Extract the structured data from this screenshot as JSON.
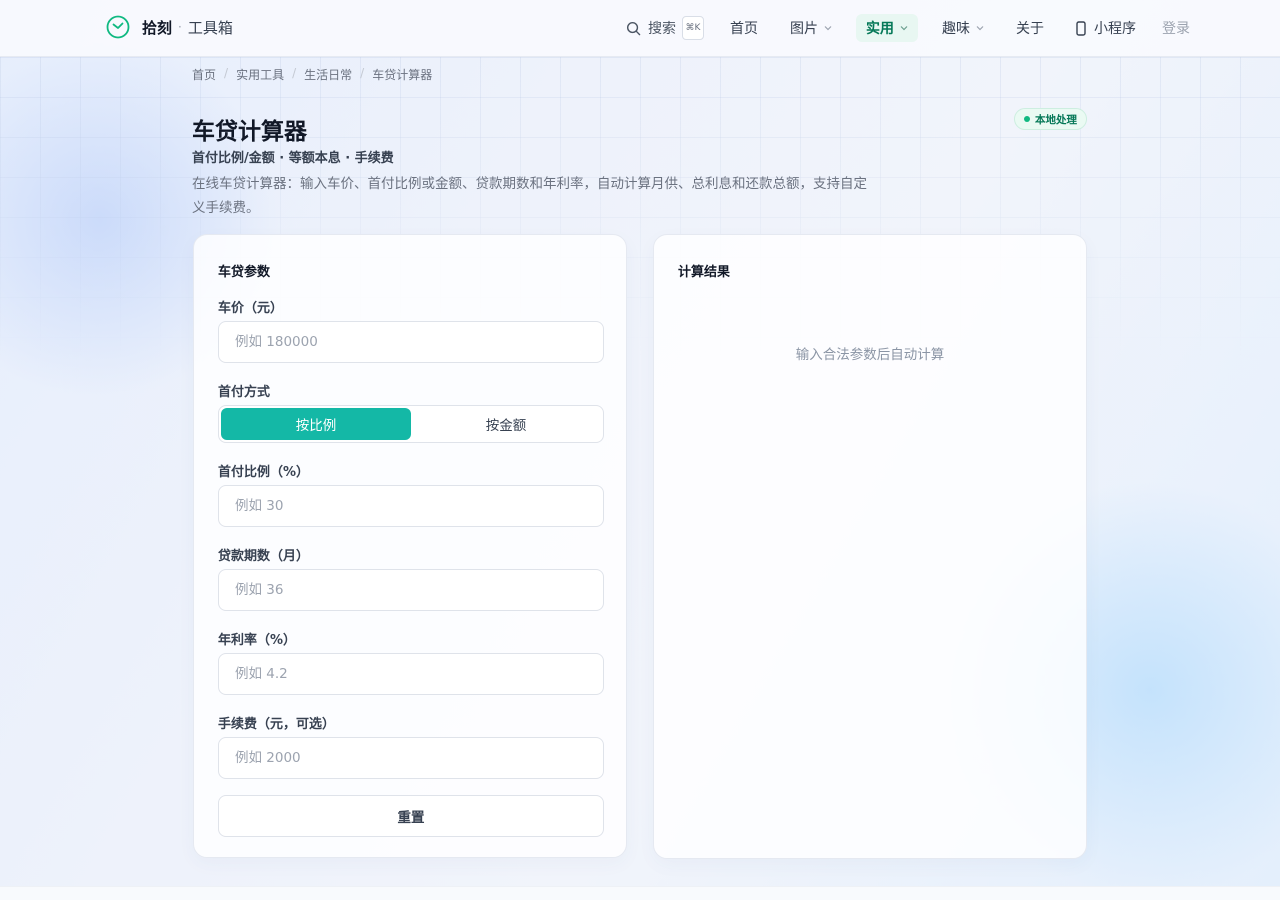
{
  "header": {
    "brand_name": "拾刻",
    "brand_sep": "·",
    "brand_sub": "工具箱",
    "search_label": "搜索",
    "search_shortcut": "⌘K",
    "nav": {
      "home": "首页",
      "images": "图片",
      "practical": "实用",
      "fun": "趣味",
      "about": "关于",
      "mini_program": "小程序",
      "login": "登录"
    }
  },
  "breadcrumb": [
    "首页",
    "实用工具",
    "生活日常",
    "车贷计算器"
  ],
  "breadcrumb_sep": "/",
  "page": {
    "title": "车贷计算器",
    "subtitle": "首付比例/金额 · 等额本息 · 手续费",
    "description": "在线车贷计算器：输入车价、首付比例或金额、贷款期数和年利率，自动计算月供、总利息和还款总额，支持自定义手续费。",
    "badge": "本地处理"
  },
  "form": {
    "title": "车贷参数",
    "car_price_label": "车价（元）",
    "car_price_placeholder": "例如 180000",
    "down_mode_label": "首付方式",
    "down_mode_ratio": "按比例",
    "down_mode_amount": "按金额",
    "down_ratio_label": "首付比例（%）",
    "down_ratio_placeholder": "例如 30",
    "term_label": "贷款期数（月）",
    "term_placeholder": "例如 36",
    "rate_label": "年利率（%）",
    "rate_placeholder": "例如 4.2",
    "fee_label": "手续费（元，可选）",
    "fee_placeholder": "例如 2000",
    "reset_label": "重置"
  },
  "result": {
    "title": "计算结果",
    "empty_hint": "输入合法参数后自动计算"
  },
  "colors": {
    "accent": "#14b8a6",
    "active_nav": "#047857",
    "badge_dot": "#10b981"
  }
}
